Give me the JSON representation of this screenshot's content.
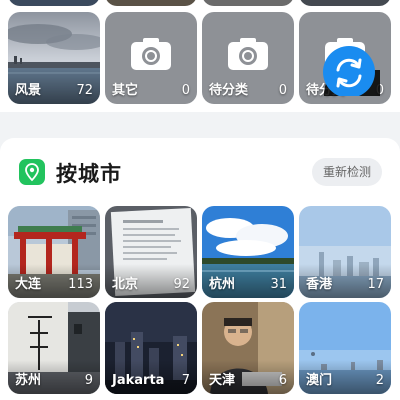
{
  "categories": [
    {
      "label": "风景",
      "count": "72"
    },
    {
      "label": "其它",
      "count": "0"
    },
    {
      "label": "待分类",
      "count": "0"
    },
    {
      "label": "待分类",
      "count": "0"
    }
  ],
  "city_section": {
    "title": "按城市",
    "redetect_label": "重新检测"
  },
  "cities": [
    {
      "label": "大连",
      "count": "113"
    },
    {
      "label": "北京",
      "count": "92"
    },
    {
      "label": "杭州",
      "count": "31"
    },
    {
      "label": "香港",
      "count": "17"
    },
    {
      "label": "苏州",
      "count": "9"
    },
    {
      "label": "Jakarta",
      "count": "7"
    },
    {
      "label": "天津",
      "count": "6"
    },
    {
      "label": "澳门",
      "count": "2"
    }
  ],
  "colors": {
    "accent_green": "#22c35e",
    "sync_blue": "#1a8cf0",
    "placeholder_gray": "#8e9196"
  },
  "icons": [
    "camera-icon",
    "sync-icon",
    "location-pin-icon"
  ]
}
